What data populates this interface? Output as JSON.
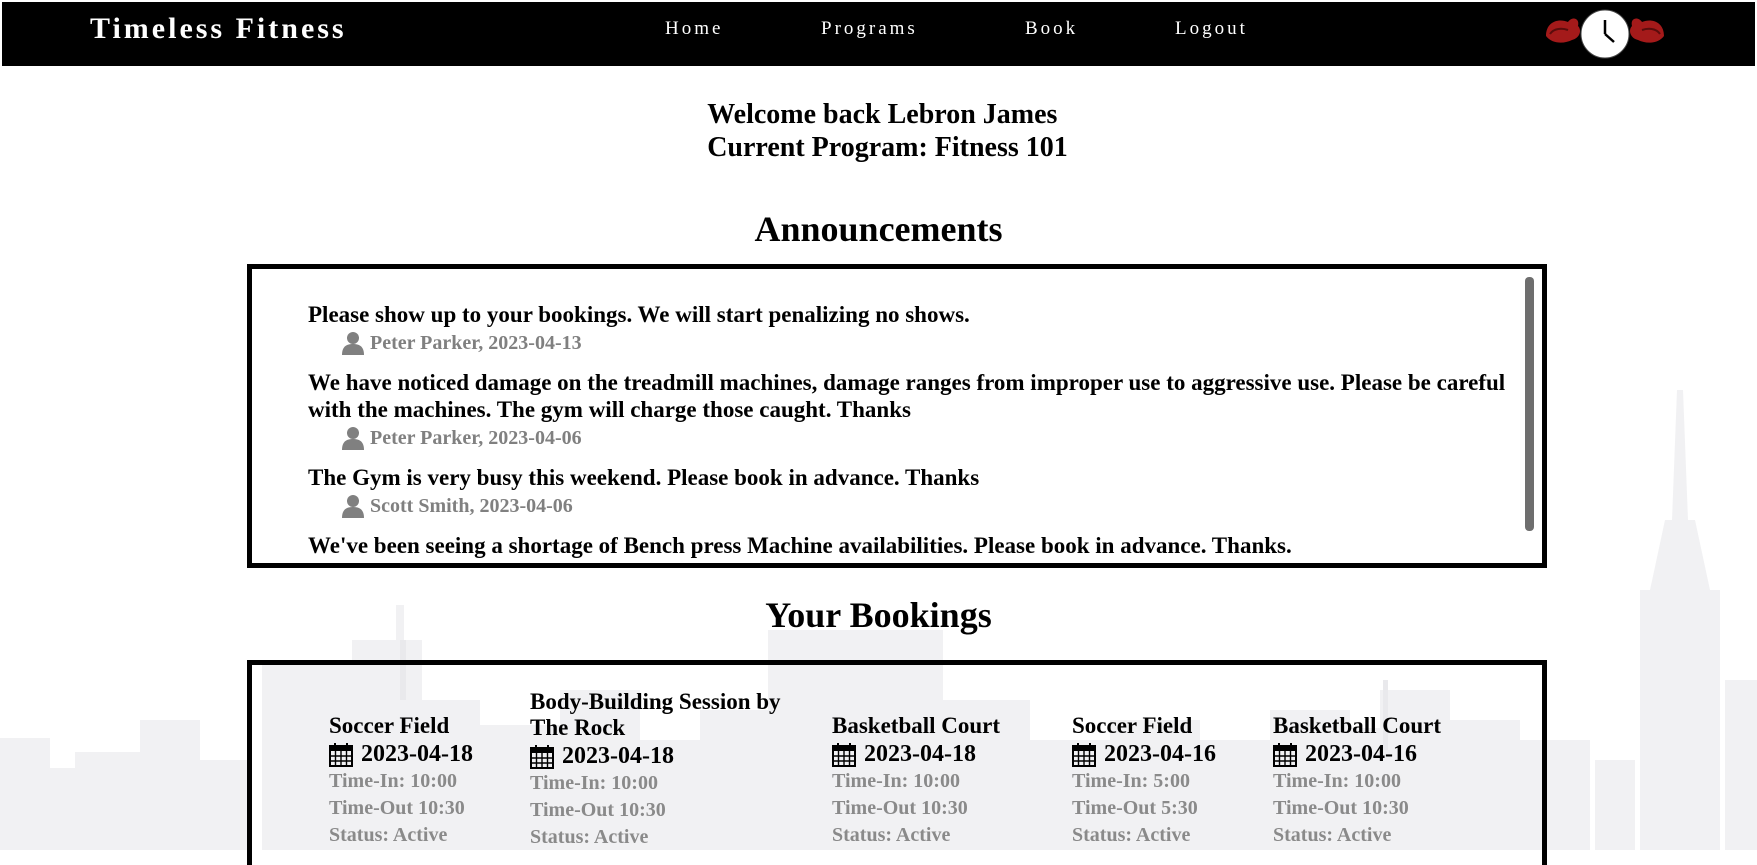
{
  "nav": {
    "brand": "Timeless Fitness",
    "links": [
      "Home",
      "Programs",
      "Book",
      "Logout"
    ],
    "logo_icon": "clock-with-flexed-arms-logo"
  },
  "welcome": {
    "line1": "Welcome back Lebron James",
    "line2": "Current Program: Fitness 101"
  },
  "announcements": {
    "title": "Announcements",
    "items": [
      {
        "text": "Please show up to your bookings. We will start penalizing no shows.",
        "meta": "Peter Parker, 2023-04-13"
      },
      {
        "text": "We have noticed damage on the treadmill machines, damage ranges from improper use to aggressive use. Please be careful with the machines. The gym will charge those caught. Thanks",
        "meta": "Peter Parker, 2023-04-06"
      },
      {
        "text": "The Gym is very busy this weekend. Please book in advance. Thanks",
        "meta": "Scott Smith, 2023-04-06"
      },
      {
        "text": "We've been seeing a shortage of Bench press Machine availabilities. Please book in advance. Thanks.",
        "meta": ""
      }
    ]
  },
  "bookings": {
    "title": "Your Bookings",
    "items": [
      {
        "title": "Soccer Field",
        "date": "2023-04-18",
        "time_in": "Time-In: 10:00",
        "time_out": "Time-Out 10:30",
        "status": "Status: Active"
      },
      {
        "title": "Body-Building Session by The Rock",
        "date": "2023-04-18",
        "time_in": "Time-In: 10:00",
        "time_out": "Time-Out 10:30",
        "status": "Status: Active"
      },
      {
        "title": "Basketball Court",
        "date": "2023-04-18",
        "time_in": "Time-In: 10:00",
        "time_out": "Time-Out 10:30",
        "status": "Status: Active"
      },
      {
        "title": "Soccer Field",
        "date": "2023-04-16",
        "time_in": "Time-In: 5:00",
        "time_out": "Time-Out 5:30",
        "status": "Status: Active"
      },
      {
        "title": "Basketball Court",
        "date": "2023-04-16",
        "time_in": "Time-In: 10:00",
        "time_out": "Time-Out 10:30",
        "status": "Status: Active"
      }
    ]
  },
  "colors": {
    "navbar": "#000000",
    "meta_text": "#808080",
    "logo_red": "#b01c1c"
  }
}
